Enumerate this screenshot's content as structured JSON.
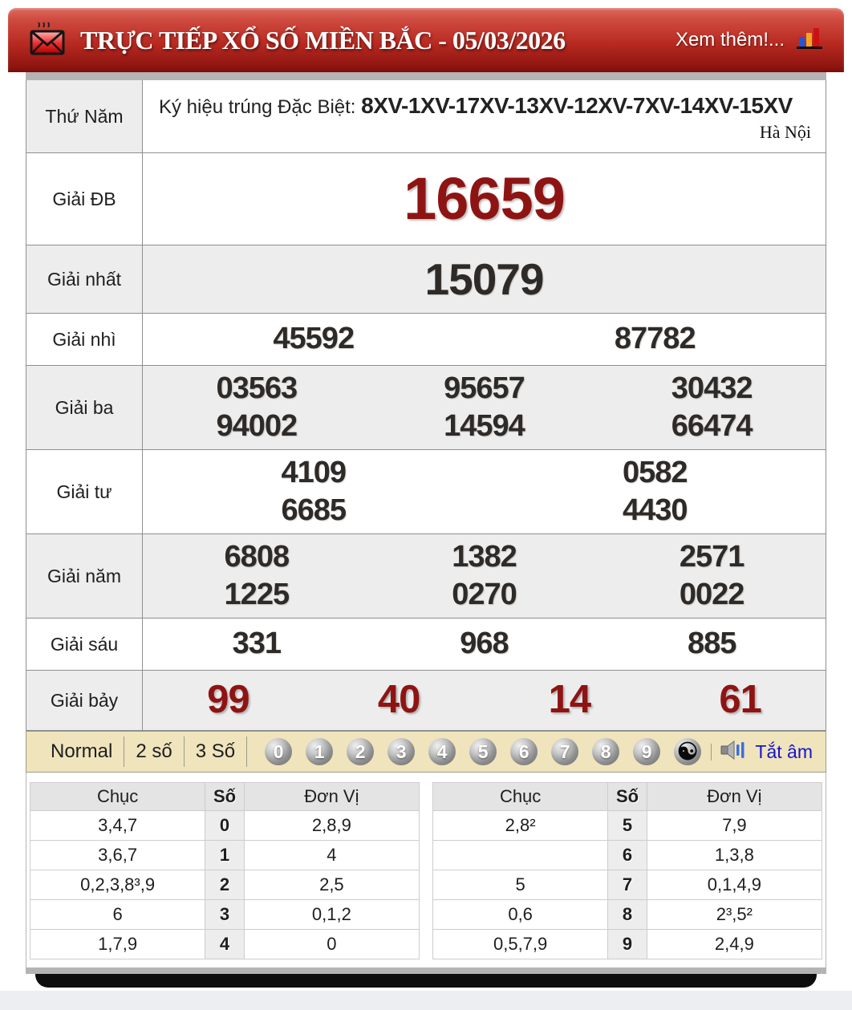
{
  "header": {
    "title": "TRỰC TIẾP XỔ SỐ MIỀN BẮC - 05/03/2026",
    "more_link": "Xem thêm!...",
    "icons": {
      "left": "envelope-icon",
      "right": "bar-chart-icon"
    }
  },
  "info_row": {
    "day_label": "Thứ Năm",
    "symbol_prefix": "Ký hiệu trúng Đặc Biệt:",
    "symbol_codes": "8XV-1XV-17XV-13XV-12XV-7XV-14XV-15XV",
    "region": "Hà Nội"
  },
  "prizes": [
    {
      "label": "Giải ĐB",
      "style": "special",
      "lines": [
        [
          "16659"
        ]
      ]
    },
    {
      "label": "Giải nhất",
      "style": "first",
      "lines": [
        [
          "15079"
        ]
      ]
    },
    {
      "label": "Giải nhì",
      "style": "normal",
      "lines": [
        [
          "45592",
          "87782"
        ]
      ]
    },
    {
      "label": "Giải ba",
      "style": "normal",
      "lines": [
        [
          "03563",
          "95657",
          "30432"
        ],
        [
          "94002",
          "14594",
          "66474"
        ]
      ]
    },
    {
      "label": "Giải tư",
      "style": "normal",
      "lines": [
        [
          "4109",
          "0582"
        ],
        [
          "6685",
          "4430"
        ]
      ]
    },
    {
      "label": "Giải năm",
      "style": "normal",
      "lines": [
        [
          "6808",
          "1382",
          "2571"
        ],
        [
          "1225",
          "0270",
          "0022"
        ]
      ]
    },
    {
      "label": "Giải sáu",
      "style": "normal",
      "lines": [
        [
          "331",
          "968",
          "885"
        ]
      ]
    },
    {
      "label": "Giải bảy",
      "style": "seventh",
      "lines": [
        [
          "99",
          "40",
          "14",
          "61"
        ]
      ]
    }
  ],
  "toolbar": {
    "buttons": [
      "Normal",
      "2 số",
      "3 Số"
    ],
    "balls": [
      "0",
      "1",
      "2",
      "3",
      "4",
      "5",
      "6",
      "7",
      "8",
      "9"
    ],
    "yinyang": "☯",
    "mute_label": "Tắt âm"
  },
  "summary_tables": [
    {
      "headers": [
        "Chục",
        "Số",
        "Đơn Vị"
      ],
      "rows": [
        {
          "tens": "3,4,7",
          "digit": "0",
          "units": "2,8,9"
        },
        {
          "tens": "3,6,7",
          "digit": "1",
          "units": "4"
        },
        {
          "tens": "0,2,3,8³,9",
          "digit": "2",
          "units": "2,5"
        },
        {
          "tens": "6",
          "digit": "3",
          "units": "0,1,2"
        },
        {
          "tens": "1,7,9",
          "digit": "4",
          "units": "0"
        }
      ]
    },
    {
      "headers": [
        "Chục",
        "Số",
        "Đơn Vị"
      ],
      "rows": [
        {
          "tens": "2,8²",
          "digit": "5",
          "units": "7,9"
        },
        {
          "tens": "",
          "digit": "6",
          "units": "1,3,8"
        },
        {
          "tens": "5",
          "digit": "7",
          "units": "0,1,4,9"
        },
        {
          "tens": "0,6",
          "digit": "8",
          "units": "2³,5²"
        },
        {
          "tens": "0,5,7,9",
          "digit": "9",
          "units": "2,4,9"
        }
      ]
    }
  ],
  "colors": {
    "header_red": "#b82a21",
    "prize_red": "#8e1414",
    "number_dark": "#2e2a27",
    "toolbar_bg": "#f0e4bd",
    "mute_blue": "#1515cc",
    "row_alt_gray": "#ededed"
  }
}
